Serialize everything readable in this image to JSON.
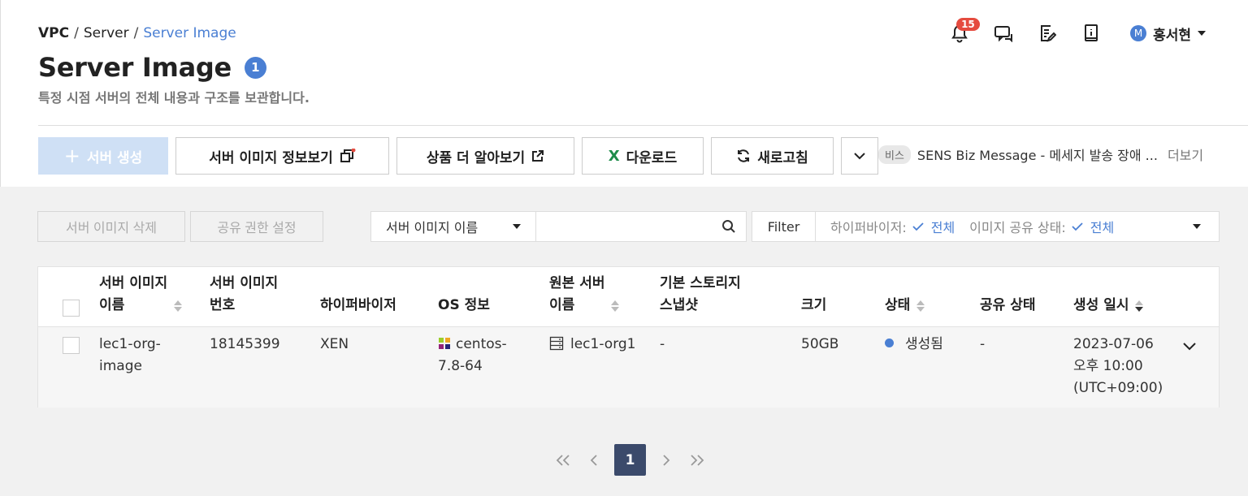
{
  "breadcrumb": {
    "root": "VPC",
    "mid": "Server",
    "current": "Server Image"
  },
  "page": {
    "title": "Server Image",
    "badge": "1",
    "subtitle": "특정 시점 서버의 전체 내용과 구조를 보관합니다."
  },
  "header": {
    "notifications": "15",
    "user_initial": "M",
    "user_name": "홍서현"
  },
  "actions": {
    "create": "서버 생성",
    "view_info": "서버 이미지 정보보기",
    "learn_more": "상품 더 알아보기",
    "download": "다운로드",
    "refresh": "새로고침"
  },
  "notice": {
    "tag": "비스",
    "text": "SENS Biz Message - 메세지 발송 장애 ...",
    "more": "더보기"
  },
  "toolbar": {
    "delete": "서버 이미지 삭제",
    "share_settings": "공유 권한 설정",
    "search_field": "서버 이미지 이름",
    "search_placeholder": "",
    "filter_label": "Filter",
    "filter_hypervisor_label": "하이퍼바이저:",
    "filter_hypervisor_value": "전체",
    "filter_share_label": "이미지 공유 상태:",
    "filter_share_value": "전체"
  },
  "table": {
    "headers": {
      "name": [
        "서버 이미지",
        "이름"
      ],
      "number": [
        "서버 이미지",
        "번호"
      ],
      "hypervisor": "하이퍼바이저",
      "os": "OS 정보",
      "origin_server": [
        "원본 서버",
        "이름"
      ],
      "snapshot": [
        "기본 스토리지",
        "스냅샷"
      ],
      "size": "크기",
      "status": "상태",
      "share_status": "공유 상태",
      "created": "생성 일시"
    },
    "rows": [
      {
        "name": [
          "lec1-org-",
          "image"
        ],
        "number": "18145399",
        "hypervisor": "XEN",
        "os": [
          "centos-",
          "7.8-64"
        ],
        "origin_server": "lec1-org1",
        "snapshot": "-",
        "size": "50GB",
        "status": "생성됨",
        "share_status": "-",
        "created": [
          "2023-07-06",
          "오후 10:00",
          "(UTC+09:00)"
        ]
      }
    ]
  },
  "pagination": {
    "current": "1"
  },
  "colors": {
    "accent": "#4a7fd3",
    "badge_red": "#e54b3f",
    "page_active": "#3b4a6b"
  }
}
